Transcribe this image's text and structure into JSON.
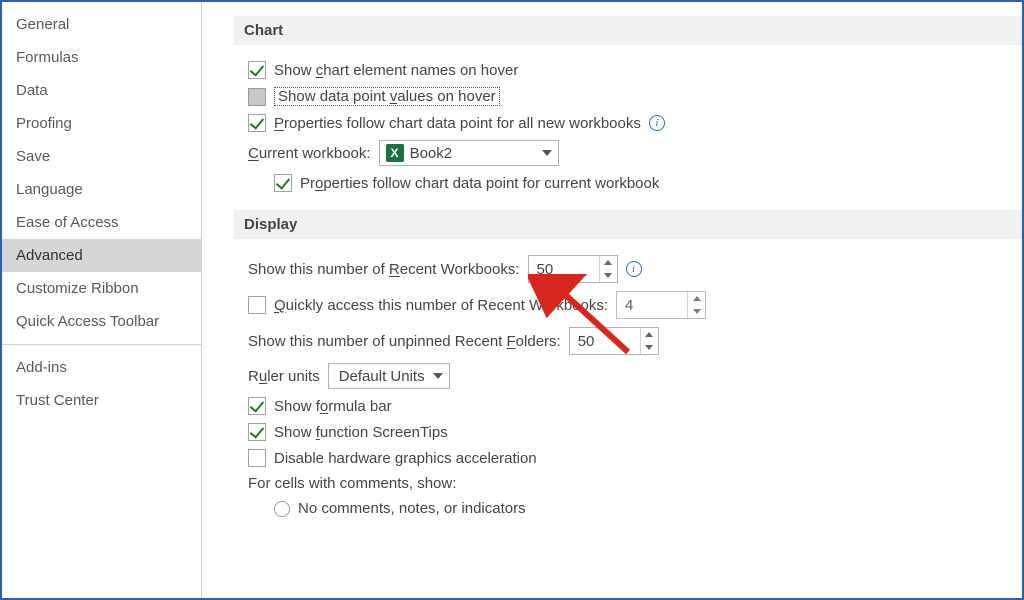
{
  "sidebar": {
    "items": [
      "General",
      "Formulas",
      "Data",
      "Proofing",
      "Save",
      "Language",
      "Ease of Access",
      "Advanced",
      "Customize Ribbon",
      "Quick Access Toolbar",
      "Add-ins",
      "Trust Center"
    ],
    "selected": "Advanced"
  },
  "sections": {
    "chart": {
      "title": "Chart",
      "show_element_names": {
        "label_pre": "Show ",
        "accel": "c",
        "label_post": "hart element names on hover",
        "checked": true
      },
      "show_point_values": {
        "label_pre": "Show data point ",
        "accel": "v",
        "label_post": "alues on hover",
        "checked": false,
        "focused": true
      },
      "props_all_wb": {
        "label_pre": "",
        "accel": "P",
        "label_post": "roperties follow chart data point for all new workbooks",
        "checked": true,
        "info": true
      },
      "current_wb": {
        "label_pre": "",
        "accel": "C",
        "label_post": "urrent workbook:",
        "value": "Book2"
      },
      "props_current_wb": {
        "label_pre": "Pr",
        "accel": "o",
        "label_post": "perties follow chart data point for current workbook",
        "checked": true
      }
    },
    "display": {
      "title": "Display",
      "recent_workbooks": {
        "label_pre": "Show this number of ",
        "accel": "R",
        "label_post": "ecent Workbooks:",
        "value": "50",
        "info": true
      },
      "quick_access": {
        "label_pre": "",
        "accel": "Q",
        "label_post": "uickly access this number of Recent Workbooks:",
        "checked": false,
        "value": "4"
      },
      "recent_folders": {
        "label_pre": "Show this number of unpinned Recent ",
        "accel": "F",
        "label_post": "olders:",
        "value": "50"
      },
      "ruler_units": {
        "label_pre": "R",
        "accel": "u",
        "label_post": "ler units",
        "value": "Default Units"
      },
      "formula_bar": {
        "label_pre": "Show f",
        "accel": "o",
        "label_post": "rmula bar",
        "checked": true
      },
      "screen_tips": {
        "label_pre": "Show ",
        "accel": "f",
        "label_post": "unction ScreenTips",
        "checked": true
      },
      "hw_accel": {
        "label_pre": "Disable hardware ",
        "accel": "g",
        "label_post": "raphics acceleration",
        "checked": false
      },
      "comments_hdr": "For cells with comments, show:",
      "comments_opt1": "No comments, notes, or indicators"
    }
  }
}
